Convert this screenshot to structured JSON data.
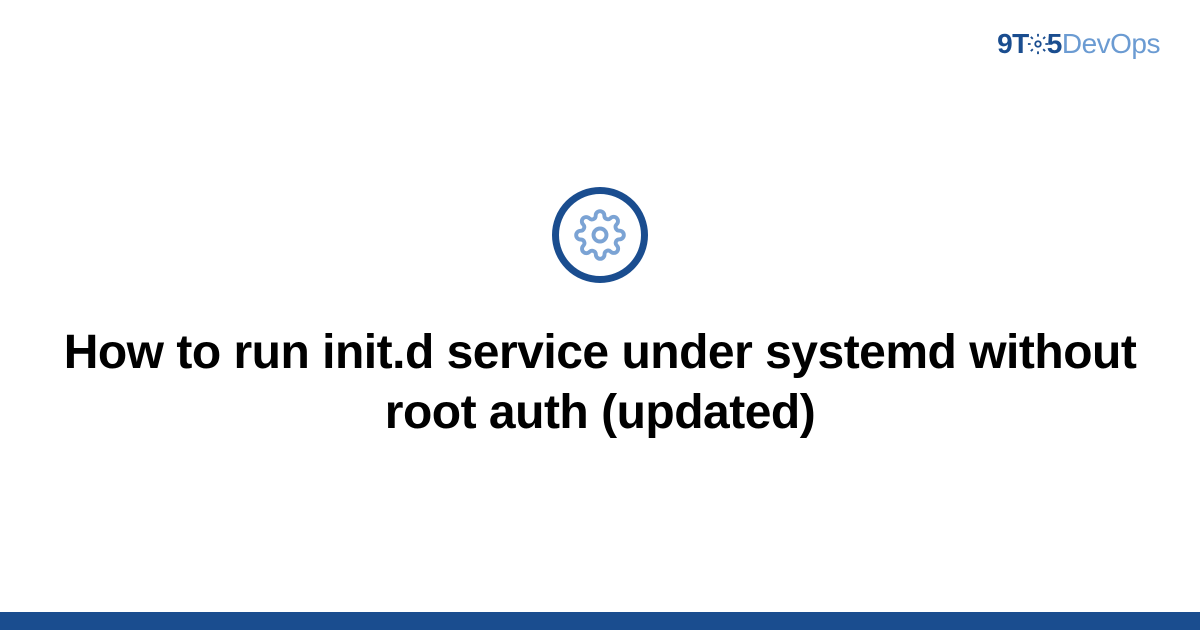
{
  "logo": {
    "part1": "9T",
    "part2": "5",
    "part3": "DevOps"
  },
  "icon": {
    "name": "gear-icon"
  },
  "title": "How to run init.d service under systemd without root auth (updated)",
  "colors": {
    "primary": "#1a4d8f",
    "secondary": "#6b9bd2"
  }
}
